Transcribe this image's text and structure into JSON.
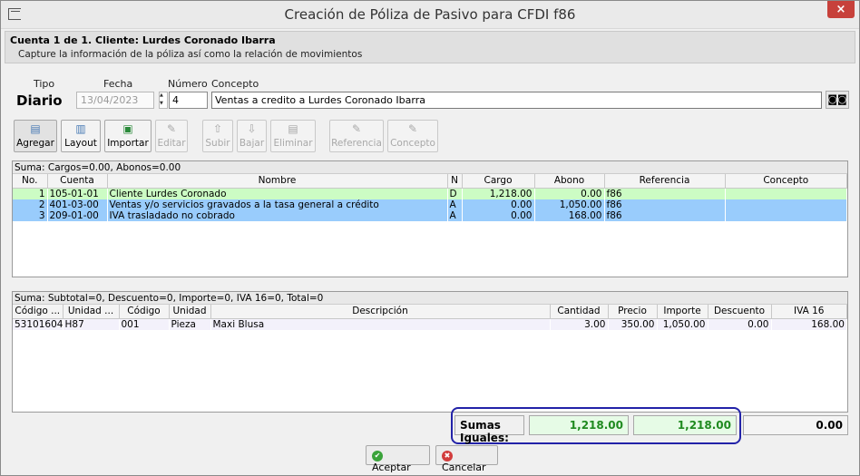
{
  "window": {
    "title": "Creación de Póliza de Pasivo para CFDI f86",
    "close": "×"
  },
  "header": {
    "line1": "Cuenta 1 de 1. Cliente: Lurdes Coronado Ibarra",
    "line2": "Capture la información de la póliza así como la relación de movimientos"
  },
  "form": {
    "tipo_label": "Tipo",
    "tipo_value": "Diario",
    "fecha_label": "Fecha",
    "fecha_value": "13/04/2023",
    "numero_label": "Número",
    "numero_value": "4",
    "concepto_label": "Concepto",
    "concepto_value": "Ventas a credito a Lurdes Coronado Ibarra"
  },
  "toolbar": {
    "agregar": "Agregar",
    "layout": "Layout",
    "importar": "Importar",
    "editar": "Editar",
    "subir": "Subir",
    "bajar": "Bajar",
    "eliminar": "Eliminar",
    "referencia": "Referencia",
    "concepto": "Concepto"
  },
  "movs": {
    "summary": "Suma: Cargos=0.00, Abonos=0.00",
    "headers": [
      "No.",
      "Cuenta",
      "Nombre",
      "N",
      "Cargo",
      "Abono",
      "Referencia",
      "Concepto"
    ],
    "rows": [
      {
        "no": "1",
        "cuenta": "105-01-01",
        "nombre": "Cliente Lurdes Coronado",
        "n": "D",
        "cargo": "1,218.00",
        "abono": "0.00",
        "ref": "f86",
        "concepto": ""
      },
      {
        "no": "2",
        "cuenta": "401-03-00",
        "nombre": "Ventas y/o servicios gravados a la tasa general a crédito",
        "n": "A",
        "cargo": "0.00",
        "abono": "1,050.00",
        "ref": "f86",
        "concepto": ""
      },
      {
        "no": "3",
        "cuenta": "209-01-00",
        "nombre": "IVA trasladado no cobrado",
        "n": "A",
        "cargo": "0.00",
        "abono": "168.00",
        "ref": "f86",
        "concepto": ""
      }
    ]
  },
  "items": {
    "summary": "Suma: Subtotal=0, Descuento=0, Importe=0, IVA 16=0, Total=0",
    "headers": [
      "Código ...",
      "Unidad ...",
      "Código",
      "Unidad",
      "Descripción",
      "Cantidad",
      "Precio",
      "Importe",
      "Descuento",
      "IVA 16"
    ],
    "rows": [
      {
        "codigo_sat": "53101604",
        "unidad_sat": "H87",
        "codigo": "001",
        "unidad": "Pieza",
        "descripcion": "Maxi Blusa",
        "cantidad": "3.00",
        "precio": "350.00",
        "importe": "1,050.00",
        "descuento": "0.00",
        "iva": "168.00"
      }
    ]
  },
  "totals": {
    "label": "Sumas Iguales:",
    "cargos": "1,218.00",
    "abonos": "1,218.00",
    "diferencia": "0.00"
  },
  "actions": {
    "aceptar": "Aceptar",
    "cancelar": "Cancelar"
  },
  "colors": {
    "row_selected": "#ccfcc4",
    "row_highlight": "#99ccfc",
    "totals_green": "#1f8a1f",
    "focus_border": "#2222a8",
    "close_red": "#c7413b"
  }
}
